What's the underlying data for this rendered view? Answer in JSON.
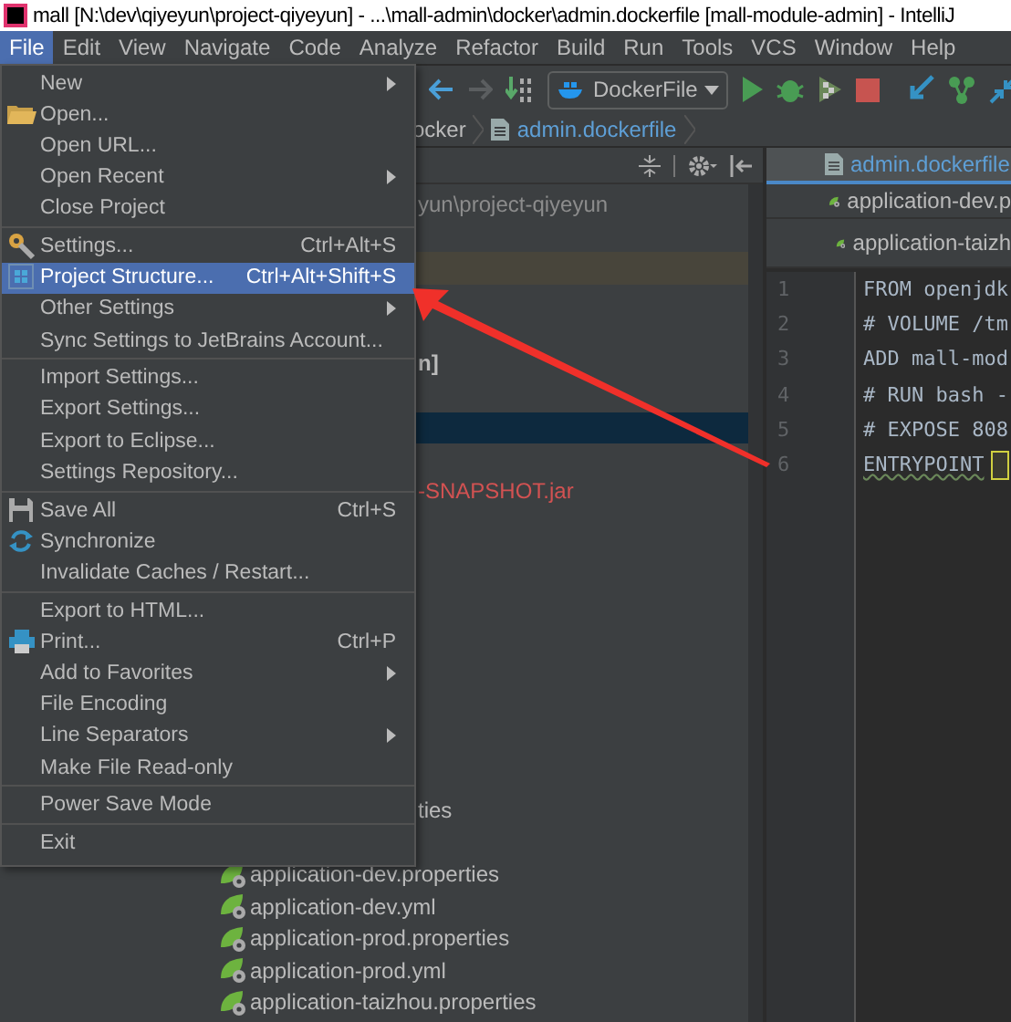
{
  "window": {
    "title": "mall [N:\\dev\\qiyeyun\\project-qiyeyun] - ...\\mall-admin\\docker\\admin.dockerfile [mall-module-admin] - IntelliJ"
  },
  "menubar": [
    {
      "label": "File",
      "selected": true
    },
    {
      "label": "Edit",
      "selected": false
    },
    {
      "label": "View",
      "selected": false
    },
    {
      "label": "Navigate",
      "selected": false
    },
    {
      "label": "Code",
      "selected": false
    },
    {
      "label": "Analyze",
      "selected": false
    },
    {
      "label": "Refactor",
      "selected": false
    },
    {
      "label": "Build",
      "selected": false
    },
    {
      "label": "Run",
      "selected": false
    },
    {
      "label": "Tools",
      "selected": false
    },
    {
      "label": "VCS",
      "selected": false
    },
    {
      "label": "Window",
      "selected": false
    },
    {
      "label": "Help",
      "selected": false
    }
  ],
  "toolbar": {
    "run_config": "DockerFile"
  },
  "breadcrumbs": [
    "ocker",
    "admin.dockerfile"
  ],
  "file_menu": [
    {
      "kind": "item",
      "label": "New",
      "submenu": true,
      "selected": false
    },
    {
      "kind": "item",
      "label": "Open...",
      "selected": false
    },
    {
      "kind": "item",
      "label": "Open URL...",
      "selected": false
    },
    {
      "kind": "item",
      "label": "Open Recent",
      "submenu": true,
      "selected": false
    },
    {
      "kind": "item",
      "label": "Close Project",
      "selected": false
    },
    {
      "kind": "separator"
    },
    {
      "kind": "item",
      "label": "Settings...",
      "shortcut": "Ctrl+Alt+S",
      "selected": false
    },
    {
      "kind": "item",
      "label": "Project Structure...",
      "shortcut": "Ctrl+Alt+Shift+S",
      "selected": true
    },
    {
      "kind": "item",
      "label": "Other Settings",
      "submenu": true,
      "selected": false
    },
    {
      "kind": "item",
      "label": "Sync Settings to JetBrains Account...",
      "selected": false
    },
    {
      "kind": "separator"
    },
    {
      "kind": "item",
      "label": "Import Settings...",
      "selected": false
    },
    {
      "kind": "item",
      "label": "Export Settings...",
      "selected": false
    },
    {
      "kind": "item",
      "label": "Export to Eclipse...",
      "selected": false
    },
    {
      "kind": "item",
      "label": "Settings Repository...",
      "selected": false
    },
    {
      "kind": "separator"
    },
    {
      "kind": "item",
      "label": "Save All",
      "shortcut": "Ctrl+S",
      "selected": false
    },
    {
      "kind": "item",
      "label": "Synchronize",
      "selected": false
    },
    {
      "kind": "item",
      "label": "Invalidate Caches / Restart...",
      "selected": false
    },
    {
      "kind": "separator"
    },
    {
      "kind": "item",
      "label": "Export to HTML...",
      "selected": false
    },
    {
      "kind": "item",
      "label": "Print...",
      "shortcut": "Ctrl+P",
      "selected": false
    },
    {
      "kind": "item",
      "label": "Add to Favorites",
      "submenu": true,
      "selected": false
    },
    {
      "kind": "item",
      "label": "File Encoding",
      "selected": false
    },
    {
      "kind": "item",
      "label": "Line Separators",
      "submenu": true,
      "selected": false
    },
    {
      "kind": "item",
      "label": "Make File Read-only",
      "selected": false
    },
    {
      "kind": "separator"
    },
    {
      "kind": "item",
      "label": "Power Save Mode",
      "selected": false
    },
    {
      "kind": "separator"
    },
    {
      "kind": "item",
      "label": "Exit",
      "selected": false
    }
  ],
  "project_tree": {
    "rows": [
      {
        "kind": "path",
        "text": "yun\\project-qiyeyun",
        "selected": false
      },
      {
        "kind": "blank"
      },
      {
        "kind": "bar",
        "selected": false
      },
      {
        "kind": "blank"
      },
      {
        "kind": "blank"
      },
      {
        "kind": "module",
        "text": "n]",
        "selected": false
      },
      {
        "kind": "blank"
      },
      {
        "kind": "bar",
        "selected": true
      },
      {
        "kind": "blank"
      },
      {
        "kind": "excluded",
        "text": "-SNAPSHOT.jar",
        "selected": false
      },
      {
        "kind": "blank"
      },
      {
        "kind": "blank"
      },
      {
        "kind": "blank"
      },
      {
        "kind": "blank"
      },
      {
        "kind": "blank"
      },
      {
        "kind": "blank"
      },
      {
        "kind": "blank"
      },
      {
        "kind": "blank"
      },
      {
        "kind": "blank"
      },
      {
        "kind": "file",
        "text": "ties",
        "selected": false
      },
      {
        "kind": "blank"
      },
      {
        "kind": "spring-file",
        "text": "application-dev.properties",
        "selected": false
      },
      {
        "kind": "spring-file",
        "text": "application-dev.yml",
        "selected": false
      },
      {
        "kind": "spring-file",
        "text": "application-prod.properties",
        "selected": false
      },
      {
        "kind": "spring-file",
        "text": "application-prod.yml",
        "selected": false
      },
      {
        "kind": "spring-file",
        "text": "application-taizhou.properties",
        "selected": false
      }
    ]
  },
  "editor": {
    "tabs": [
      {
        "kind": "docker",
        "label": "admin.dockerfile",
        "selected": true
      },
      {
        "kind": "spring",
        "label": "application-dev.p",
        "selected": false
      },
      {
        "kind": "spring",
        "label": "application-taizh",
        "selected": false
      }
    ],
    "lines": [
      {
        "number": "1",
        "kind": "code",
        "text": "FROM openjdk"
      },
      {
        "number": "2",
        "kind": "comment",
        "text": "# VOLUME /tm"
      },
      {
        "number": "3",
        "kind": "code",
        "text": "ADD mall-mod"
      },
      {
        "number": "4",
        "kind": "comment",
        "text": "# RUN bash -"
      },
      {
        "number": "5",
        "kind": "comment",
        "text": "# EXPOSE 808"
      },
      {
        "number": "6",
        "kind": "warning",
        "text": "ENTRYPOINT"
      }
    ]
  }
}
